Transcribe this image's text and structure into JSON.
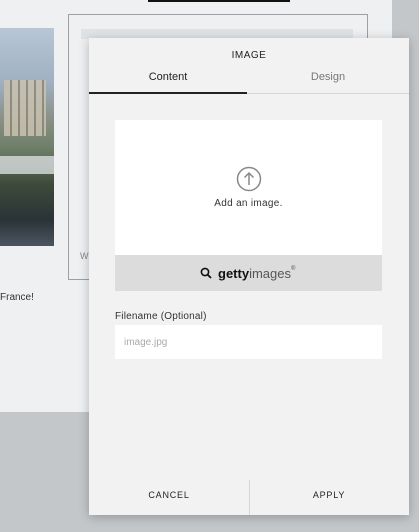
{
  "background": {
    "partial_caption": "W",
    "partial_text": "France!"
  },
  "dialog": {
    "title": "IMAGE",
    "tabs": [
      {
        "label": "Content",
        "active": true
      },
      {
        "label": "Design",
        "active": false
      }
    ],
    "dropzone": {
      "icon": "upload-arrow-icon",
      "label": "Add an image."
    },
    "getty": {
      "icon": "search-icon",
      "brand_bold": "getty",
      "brand_light": "images",
      "brand_mark": "®"
    },
    "filename": {
      "label": "Filename (Optional)",
      "value": "",
      "placeholder": "image.jpg"
    },
    "footer": {
      "cancel_label": "CANCEL",
      "apply_label": "APPLY"
    }
  }
}
